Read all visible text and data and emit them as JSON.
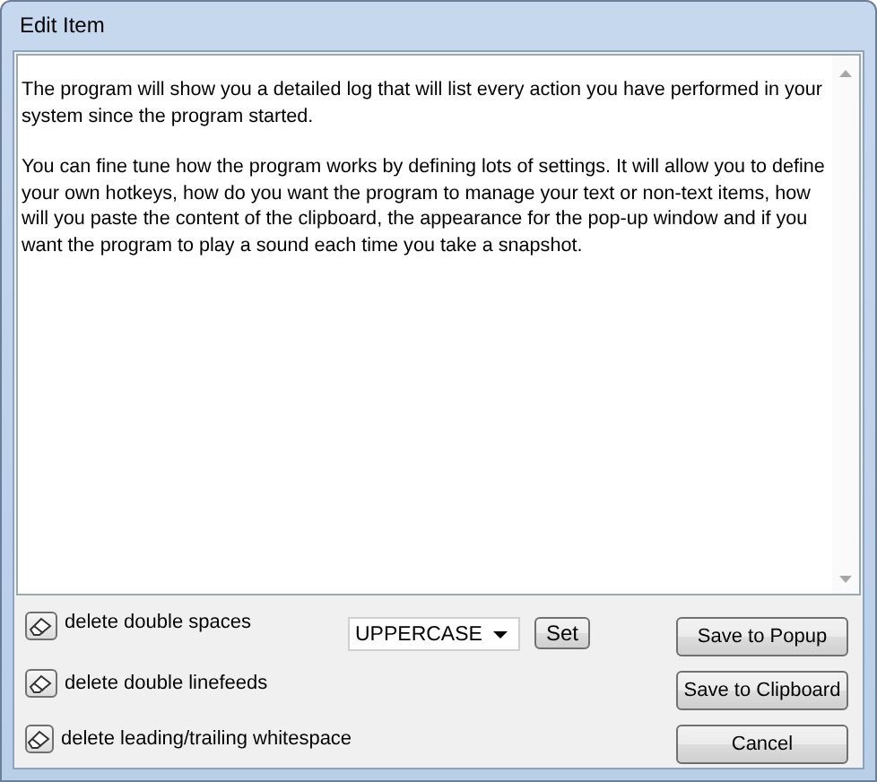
{
  "window": {
    "title": "Edit Item"
  },
  "text_area": {
    "paragraphs": [
      "The program will show you a detailed log that will list every action you have performed in your system since the program started.",
      "You can fine tune how the program works by defining lots of settings. It will allow you to define your own hotkeys, how do you want the program to manage your text or non-text items, how will you paste the content of the clipboard, the appearance for the pop-up window and if you want the program to play a sound each time you take a snapshot."
    ]
  },
  "actions": [
    {
      "label": "delete double spaces"
    },
    {
      "label": "delete double linefeeds"
    },
    {
      "label": "delete leading/trailing whitespace"
    }
  ],
  "case_dropdown": {
    "value": "UPPERCASE"
  },
  "set_button": "Set",
  "buttons": [
    "Save to Popup",
    "Save to Clipboard",
    "Cancel"
  ]
}
